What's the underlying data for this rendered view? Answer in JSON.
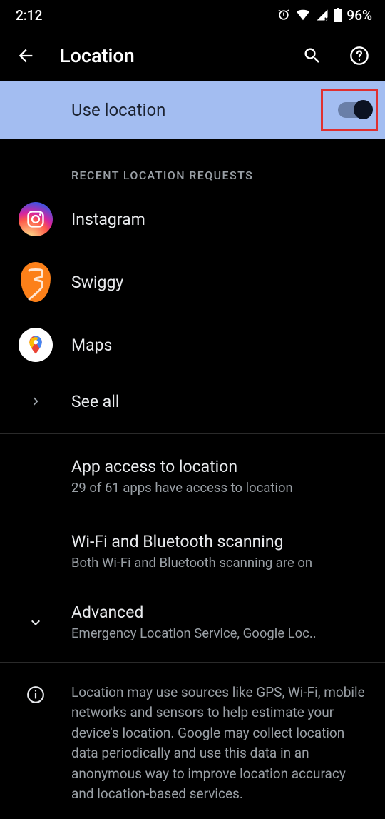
{
  "status_bar": {
    "time": "2:12",
    "battery": "96%"
  },
  "header": {
    "title": "Location"
  },
  "toggle": {
    "label": "Use location",
    "on": true
  },
  "recent": {
    "header": "RECENT LOCATION REQUESTS",
    "apps": [
      {
        "name": "Instagram"
      },
      {
        "name": "Swiggy"
      },
      {
        "name": "Maps"
      }
    ],
    "see_all": "See all"
  },
  "settings": [
    {
      "title": "App access to location",
      "subtitle": "29 of 61 apps have access to location"
    },
    {
      "title": "Wi-Fi and Bluetooth scanning",
      "subtitle": "Both Wi-Fi and Bluetooth scanning are on"
    },
    {
      "title": "Advanced",
      "subtitle": "Emergency Location Service, Google Loc.."
    }
  ],
  "info_text": "Location may use sources like GPS, Wi-Fi, mobile networks and sensors to help estimate your device's location. Google may collect location data periodically and use this data in an anonymous way to improve location accuracy and location-based services."
}
